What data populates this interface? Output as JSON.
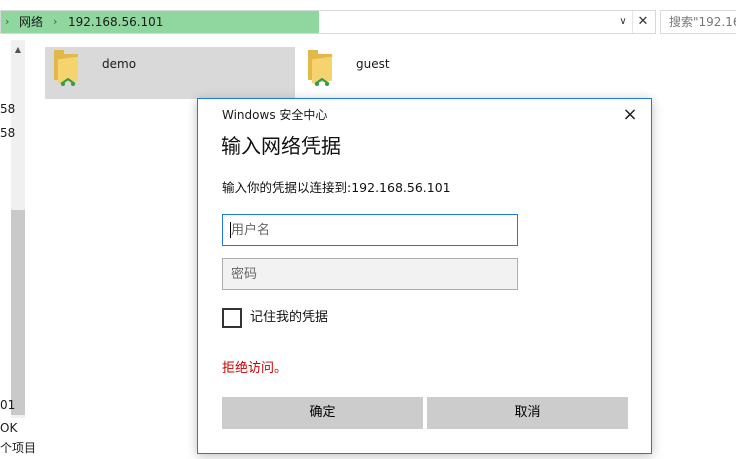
{
  "address_bar": {
    "segments": [
      "网络",
      "192.168.56.101"
    ],
    "search_placeholder": "搜索\"192.16"
  },
  "left_pane": {
    "fragments": [
      "58",
      "58",
      "01",
      "OK",
      "个项目"
    ]
  },
  "files": [
    {
      "name": "demo",
      "selected": true
    },
    {
      "name": "guest",
      "selected": false
    }
  ],
  "dialog": {
    "window_title": "Windows 安全中心",
    "heading": "输入网络凭据",
    "prompt": "输入你的凭据以连接到:192.168.56.101",
    "username_placeholder": "用户名",
    "password_placeholder": "密码",
    "remember_label": "记住我的凭据",
    "remember_checked": false,
    "error": "拒绝访问。",
    "ok_label": "确定",
    "cancel_label": "取消",
    "close_glyph": "×"
  },
  "colors": {
    "accent": "#1f7bd6",
    "progress_green": "#8fd79e",
    "error_red": "#c50000",
    "button_gray": "#cccccc"
  }
}
